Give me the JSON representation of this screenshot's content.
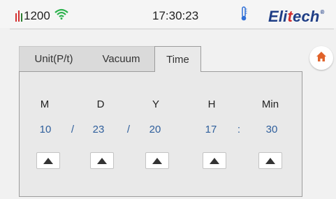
{
  "status": {
    "value": "1200",
    "time": "17:30:23",
    "signal_icon": "signal-bars-icon",
    "wifi_icon": "wifi-icon",
    "thermometer_icon": "thermometer-icon"
  },
  "brand": {
    "logo_part1": "Eli",
    "logo_accent": "t",
    "logo_part2": "ech",
    "reg_mark": "®"
  },
  "tabs": [
    {
      "label": "Unit(P/t)",
      "active": false
    },
    {
      "label": "Vacuum",
      "active": false
    },
    {
      "label": "Time",
      "active": true
    }
  ],
  "home_button": {
    "icon": "home-icon",
    "color": "#e0622a"
  },
  "fields": [
    {
      "label": "M",
      "value": "10"
    },
    {
      "label": "D",
      "value": "23"
    },
    {
      "label": "Y",
      "value": "20"
    },
    {
      "label": "H",
      "value": "17"
    },
    {
      "label": "Min",
      "value": "30"
    }
  ],
  "separators": [
    "/",
    "/",
    ":"
  ],
  "colors": {
    "value_blue": "#2f5f9c",
    "brand_blue": "#1f3e86",
    "brand_red": "#d32f2f"
  }
}
